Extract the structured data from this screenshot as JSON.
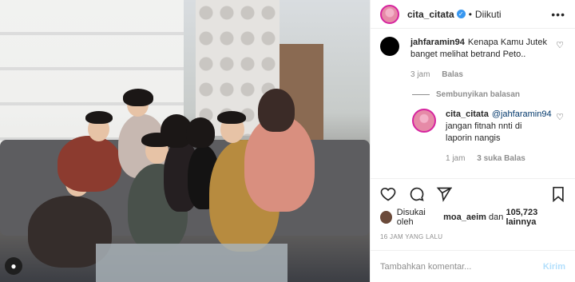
{
  "post": {
    "username": "cita_citata",
    "follow_status": "Diikuti",
    "separator": "•",
    "more_icon": "more-horizontal-icon"
  },
  "comments": [
    {
      "username": "jahfaramin94",
      "text": "Kenapa Kamu Jutek banget melihat betrand Peto..",
      "time": "3 jam",
      "reply_label": "Balas"
    }
  ],
  "hide_replies": "Sembunyikan balasan",
  "reply": {
    "username": "cita_citata",
    "mention": "@jahfaramin94",
    "text": " jangan fitnah nnti di laporin nangis",
    "time": "1 jam",
    "likes": "3 suka",
    "reply_label": "Balas"
  },
  "likes": {
    "prefix": "Disukai oleh",
    "user": "moa_aeim",
    "middle": "dan",
    "count": "105,723 lainnya"
  },
  "date": "16 JAM YANG LALU",
  "comment_input": {
    "placeholder": "Tambahkan komentar...",
    "send_label": "Kirim"
  },
  "colors": {
    "accent": "#3897f0",
    "send_disabled": "#b2dffc",
    "muted": "#8e8e8e"
  }
}
